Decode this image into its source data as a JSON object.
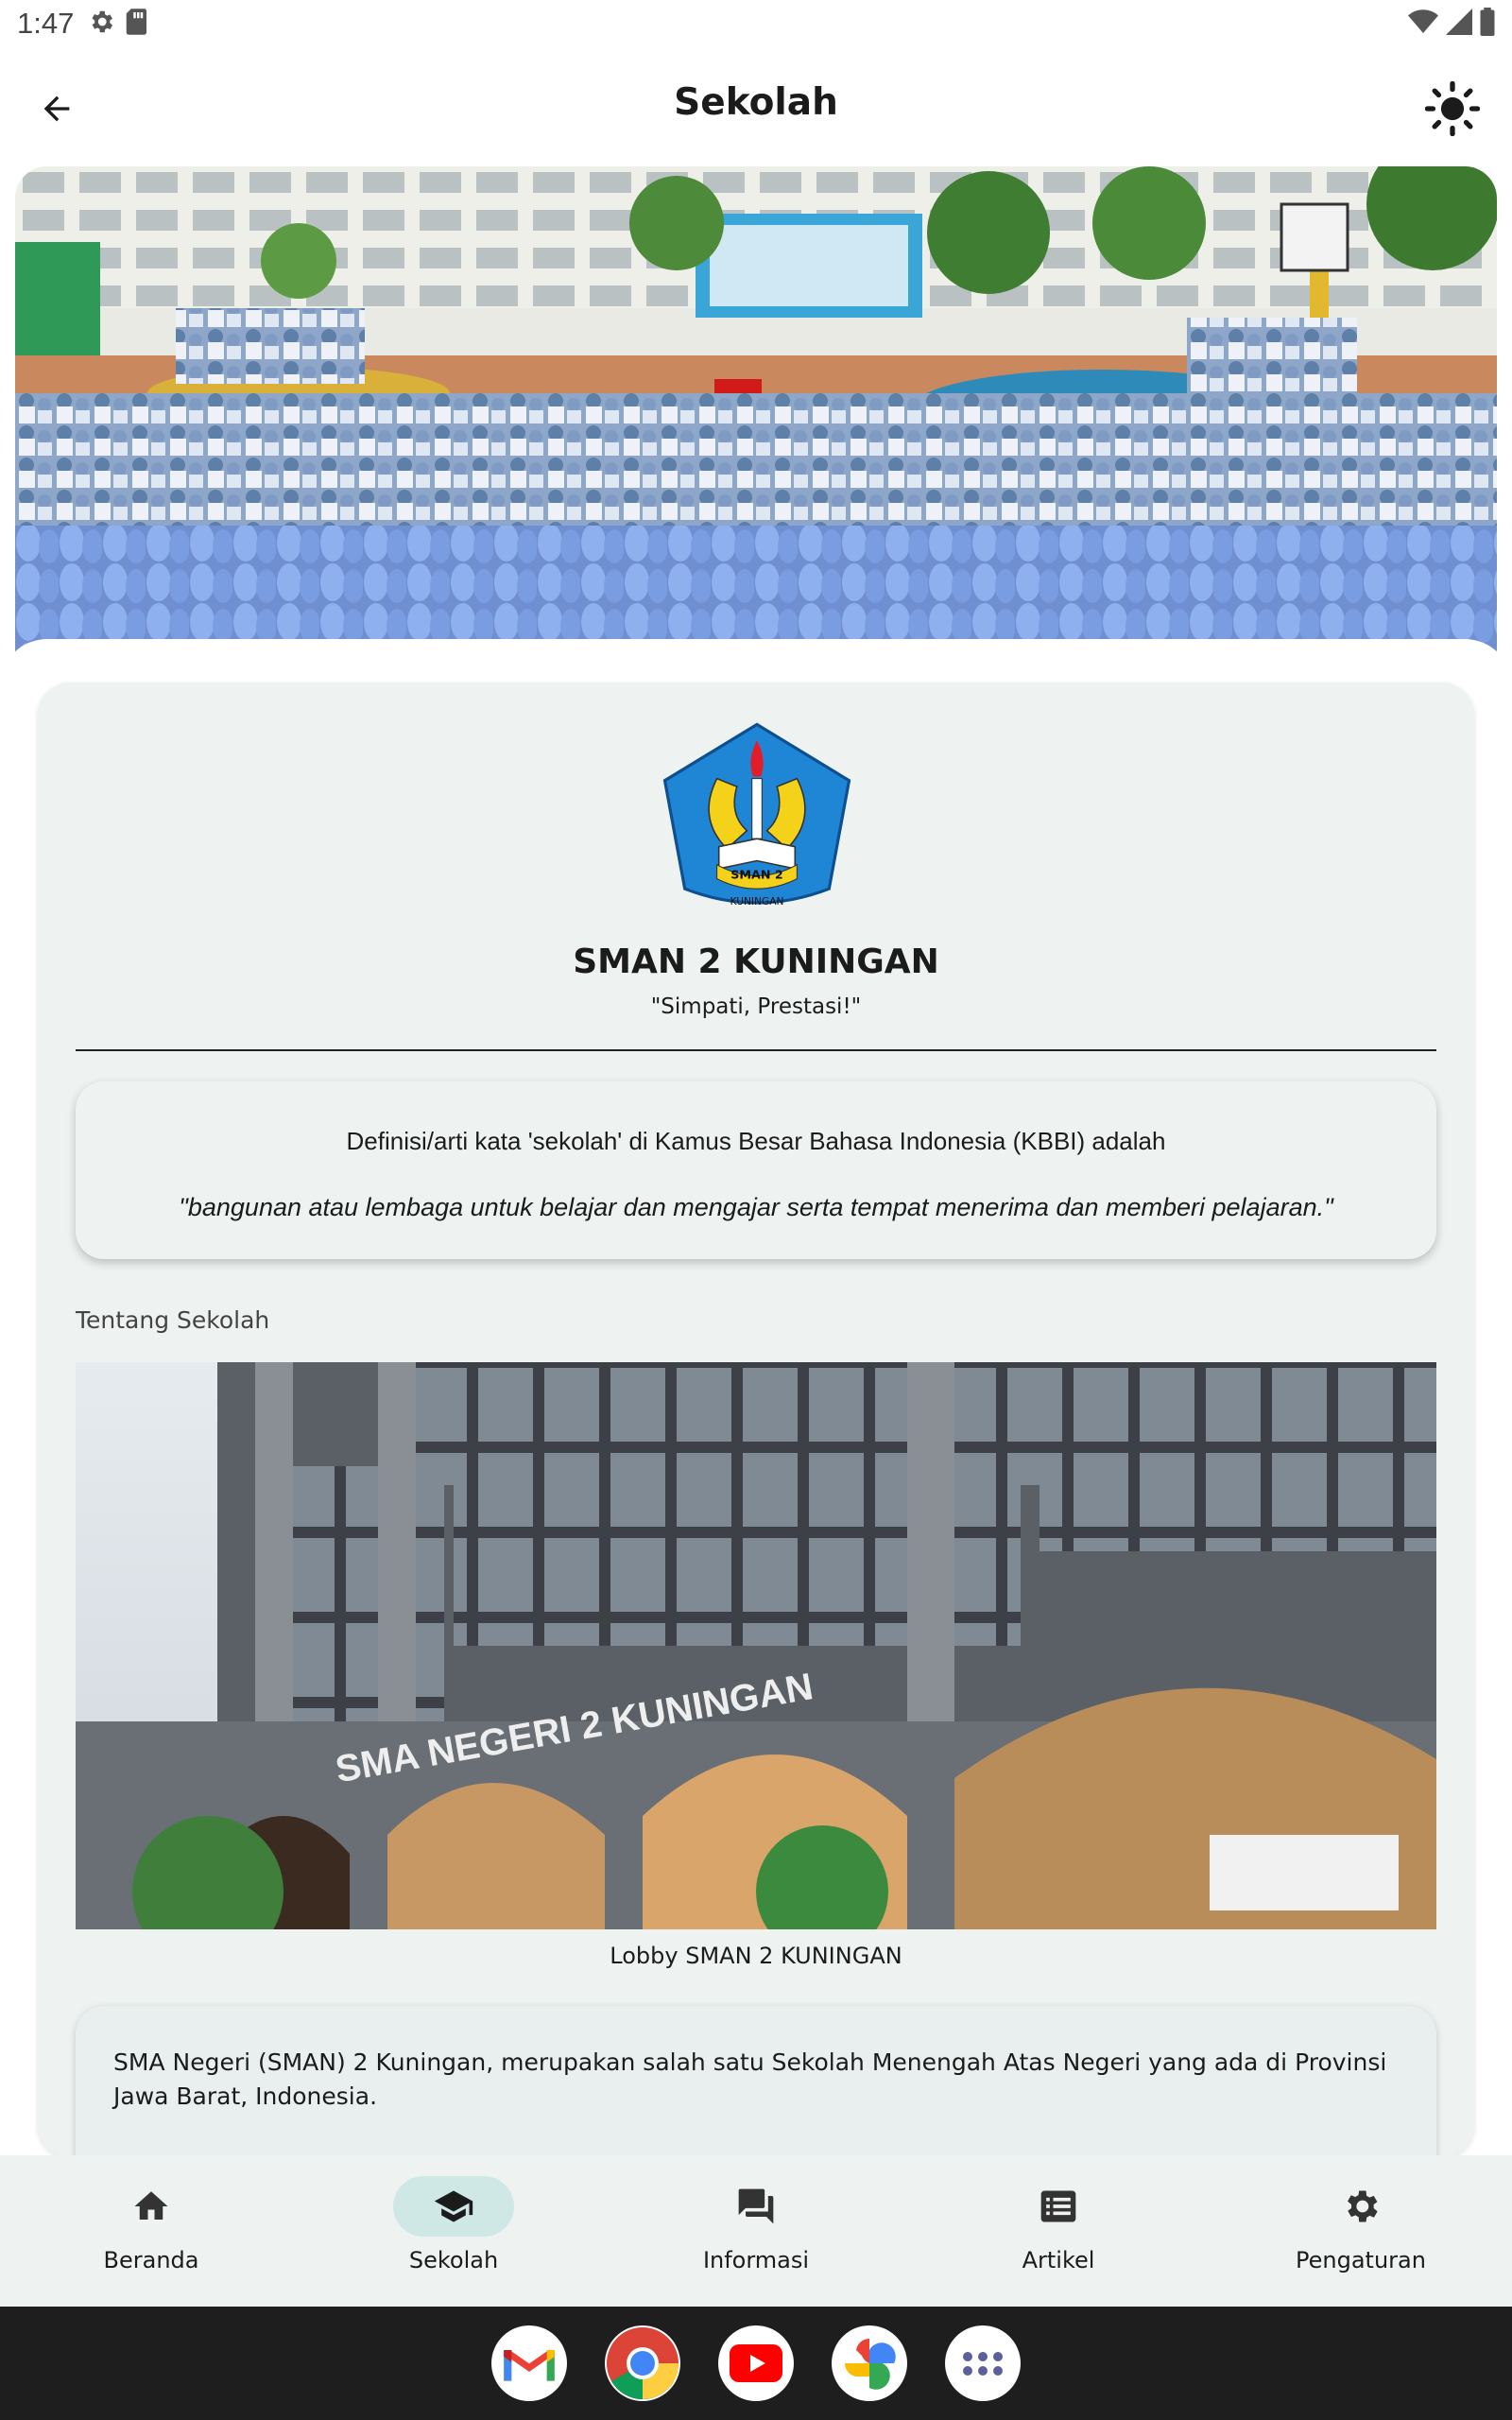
{
  "status_bar": {
    "time": "1:47"
  },
  "app_bar": {
    "title": "Sekolah"
  },
  "school": {
    "name": "SMAN 2 KUNINGAN",
    "motto": "\"Simpati, Prestasi!\"",
    "logo_text_top": "SMAN 2",
    "logo_text_bottom": "KUNINGAN"
  },
  "kbbi": {
    "definition": "Definisi/arti kata 'sekolah' di Kamus Besar Bahasa Indonesia (KBBI) adalah",
    "quote": "\"bangunan atau lembaga untuk belajar dan mengajar serta tempat menerima dan memberi pelajaran.\""
  },
  "about": {
    "label": "Tentang Sekolah",
    "image_caption": "Lobby SMAN 2 KUNINGAN",
    "building_sign": "SMA NEGERI 2 KUNINGAN",
    "description": "SMA Negeri (SMAN) 2 Kuningan, merupakan salah satu  Sekolah Menengah Atas Negeri yang ada di  Provinsi  Jawa Barat,  Indonesia."
  },
  "nav": {
    "items": [
      {
        "label": "Beranda",
        "icon": "home-icon"
      },
      {
        "label": "Sekolah",
        "icon": "school-icon",
        "active": true
      },
      {
        "label": "Informasi",
        "icon": "forum-icon"
      },
      {
        "label": "Artikel",
        "icon": "article-icon"
      },
      {
        "label": "Pengaturan",
        "icon": "gear-icon"
      }
    ]
  },
  "dock": [
    "gmail-icon",
    "chrome-icon",
    "youtube-icon",
    "photos-icon",
    "apps-icon"
  ],
  "colors": {
    "accent": "#cfe8e6",
    "card": "#eef3f2",
    "taskbar": "#1e1e1e"
  }
}
